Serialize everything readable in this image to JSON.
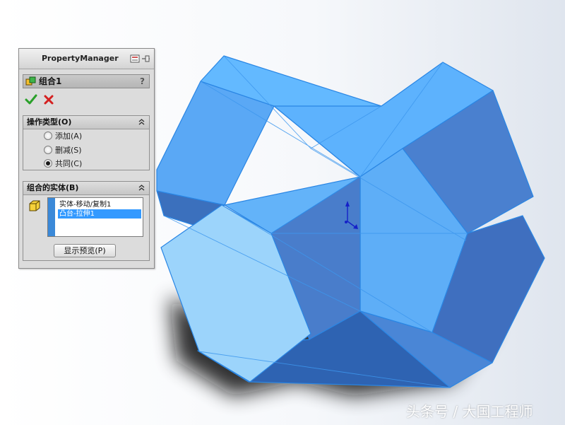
{
  "property_manager": {
    "title": "PropertyManager",
    "feature_name": "组合1",
    "help": "?",
    "operation_type": {
      "header": "操作类型(O)",
      "options": [
        {
          "label": "添加(A)",
          "selected": false
        },
        {
          "label": "删减(S)",
          "selected": false
        },
        {
          "label": "共同(C)",
          "selected": true
        }
      ]
    },
    "bodies": {
      "header": "组合的实体(B)",
      "items": [
        {
          "label": "实体-移动/复制1",
          "selected": false
        },
        {
          "label": "凸台-拉伸1",
          "selected": true
        }
      ],
      "preview_button": "显示预览(P)"
    }
  },
  "colors": {
    "body_blue": "#5aafff",
    "body_light": "#9cd4fb",
    "body_dark": "#3f72c2",
    "edge": "#2a86e4",
    "confirm_green": "#2aa02a",
    "cancel_red": "#d42020"
  },
  "icons": {
    "ok": "check-icon",
    "cancel": "x-icon",
    "feature": "combine-icon",
    "collapse": "double-chevron-up-icon",
    "body": "solid-body-icon"
  },
  "watermark": "头条号 / 大国工程师"
}
